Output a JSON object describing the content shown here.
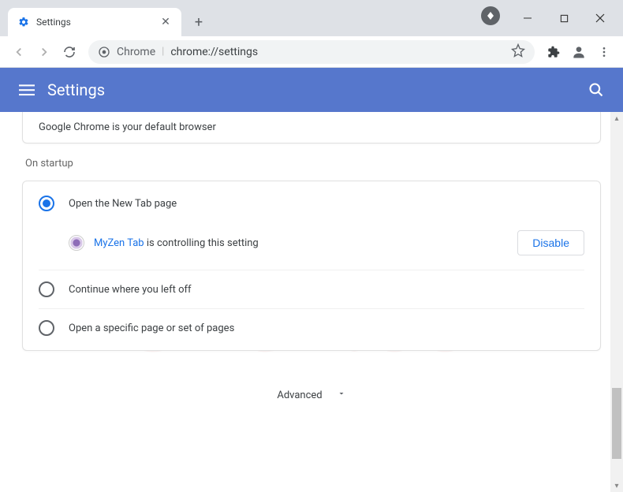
{
  "window": {
    "tab_title": "Settings"
  },
  "omnibox": {
    "prefix": "Chrome",
    "url": "chrome://settings"
  },
  "header": {
    "title": "Settings"
  },
  "default_browser": {
    "text": "Google Chrome is your default browser"
  },
  "startup": {
    "section_title": "On startup",
    "options": [
      {
        "label": "Open the New Tab page"
      },
      {
        "label": "Continue where you left off"
      },
      {
        "label": "Open a specific page or set of pages"
      }
    ],
    "extension": {
      "name": "MyZen Tab",
      "suffix": " is controlling this setting",
      "disable_label": "Disable"
    }
  },
  "advanced_label": "Advanced"
}
